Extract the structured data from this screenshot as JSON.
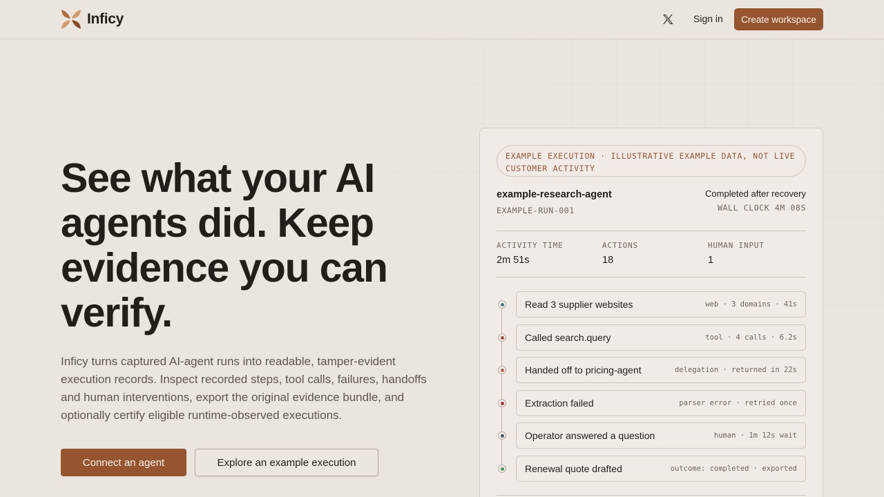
{
  "header": {
    "brand_name": "Inficy",
    "sign_in": "Sign in",
    "create_workspace": "Create workspace"
  },
  "hero": {
    "title": "See what your AI agents did. Keep evidence you can verify.",
    "description": "Inficy turns captured AI-agent runs into readable, tamper-evident execution records. Inspect recorded steps, tool calls, failures, handoffs and human interventions, export the original evidence bundle, and optionally certify eligible runtime-observed executions.",
    "primary_cta": "Connect an agent",
    "secondary_cta": "Explore an example execution"
  },
  "example": {
    "pill": "EXAMPLE EXECUTION · ILLUSTRATIVE EXAMPLE DATA, NOT LIVE CUSTOMER ACTIVITY",
    "agent_name": "example-research-agent",
    "run_id": "EXAMPLE-RUN-001",
    "status": "Completed after recovery",
    "wall_clock": "WALL CLOCK 4M 08S",
    "stats": [
      {
        "label": "ACTIVITY TIME",
        "value": "2m 51s"
      },
      {
        "label": "ACTIONS",
        "value": "18"
      },
      {
        "label": "HUMAN INPUT",
        "value": "1"
      }
    ],
    "steps": [
      {
        "title": "Read 3 supplier websites",
        "meta": "web · 3 domains · 41s",
        "color": "#3f7f78"
      },
      {
        "title": "Called search.query",
        "meta": "tool · 4 calls · 6.2s",
        "color": "#a5523a"
      },
      {
        "title": "Handed off to pricing-agent",
        "meta": "delegation · returned in 22s",
        "color": "#b5654a"
      },
      {
        "title": "Extraction failed",
        "meta": "parser error · retried once",
        "color": "#b5323a"
      },
      {
        "title": "Operator answered a question",
        "meta": "human · 1m 12s wait",
        "color": "#4b5560"
      },
      {
        "title": "Renewal quote drafted",
        "meta": "outcome: completed · exported",
        "color": "#4f9a5c"
      }
    ]
  },
  "colors": {
    "accent": "#96542f",
    "background": "#ebe5df"
  }
}
